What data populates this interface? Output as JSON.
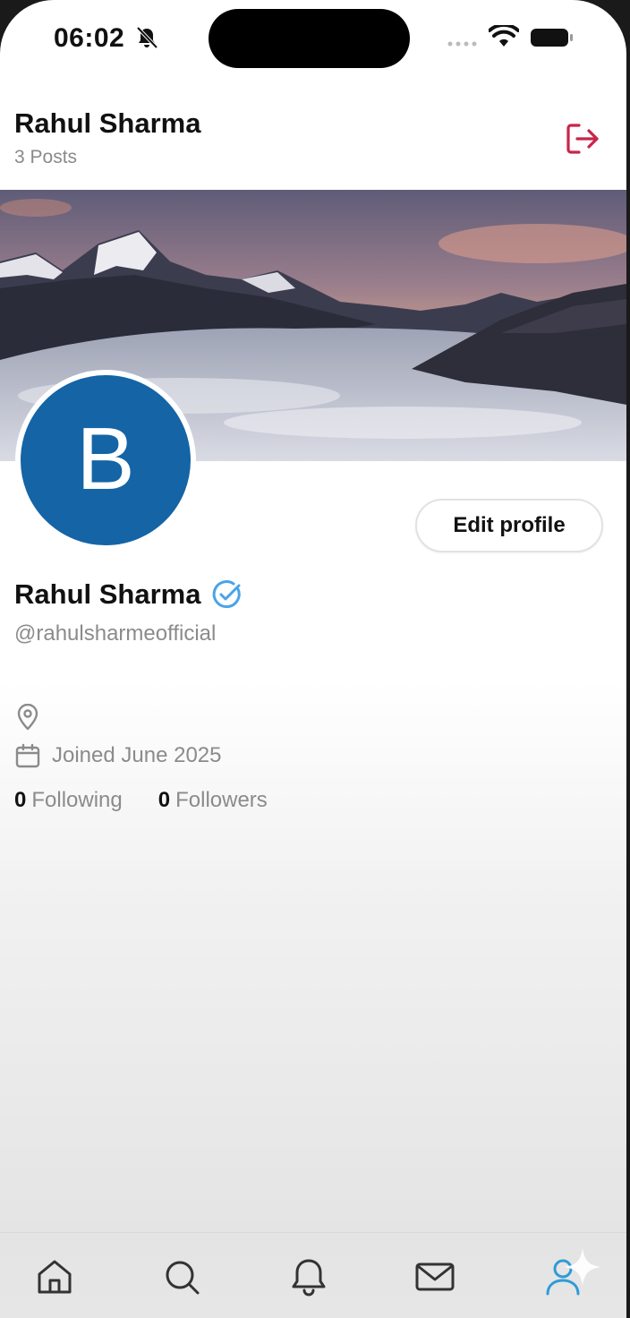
{
  "status_bar": {
    "time": "06:02"
  },
  "header": {
    "title": "Rahul Sharma",
    "posts": "3 Posts"
  },
  "profile": {
    "avatar_letter": "B",
    "name": "Rahul Sharma",
    "handle": "@rahulsharmeofficial",
    "joined": "Joined June 2025",
    "edit_label": "Edit profile",
    "following_count": "0",
    "following_label": "Following",
    "followers_count": "0",
    "followers_label": "Followers"
  },
  "colors": {
    "avatar_bg": "#1464a6",
    "verified": "#4aa3e8",
    "logout": "#c8254a",
    "active_tab": "#2f9bd6"
  },
  "icons": {
    "status": [
      "bell-slash-icon",
      "cellular-icon",
      "wifi-icon",
      "battery-icon"
    ],
    "header": "logout-icon",
    "tabs": [
      "home-icon",
      "search-icon",
      "notifications-icon",
      "messages-icon",
      "profile-icon"
    ]
  }
}
